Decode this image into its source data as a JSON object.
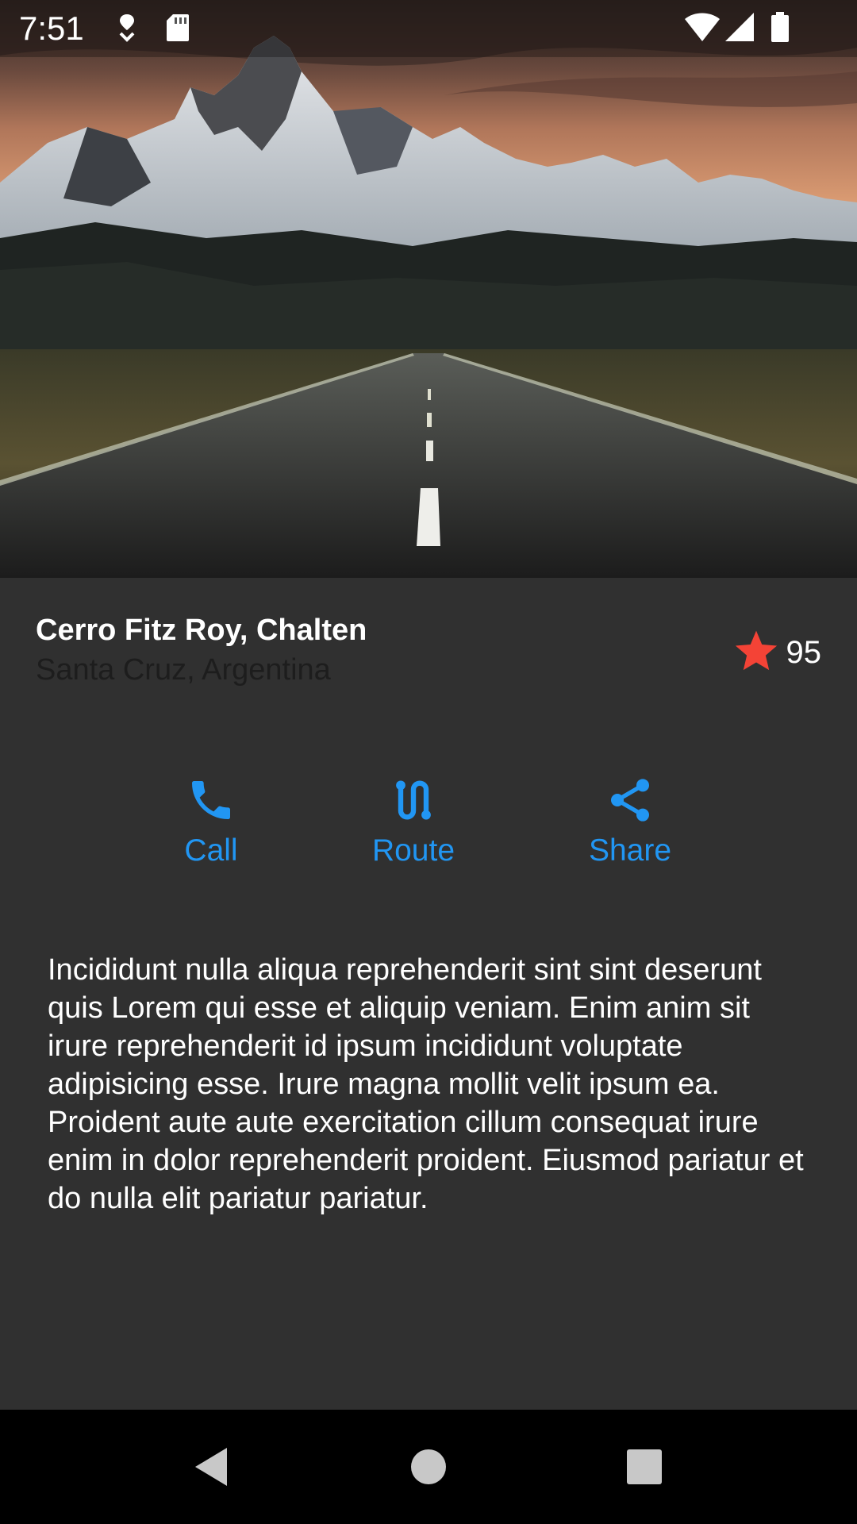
{
  "status_bar": {
    "time": "7:51"
  },
  "place": {
    "title": "Cerro Fitz Roy, Chalten",
    "subtitle": "Santa Cruz, Argentina",
    "rating_count": "95"
  },
  "actions": [
    {
      "label": "Call",
      "icon": "phone-icon"
    },
    {
      "label": "Route",
      "icon": "route-icon"
    },
    {
      "label": "Share",
      "icon": "share-icon"
    }
  ],
  "description": "Incididunt nulla aliqua reprehenderit sint sint deserunt quis Lorem qui esse et aliquip veniam. Enim anim sit irure reprehenderit id ipsum incididunt voluptate adipisicing esse. Irure magna mollit velit ipsum ea. Proident aute aute exercitation cillum consequat irure enim in dolor reprehenderit proident. Eiusmod pariatur et do nulla elit pariatur pariatur.",
  "colors": {
    "accent": "#2196f3",
    "star": "#f44336",
    "background": "#303030",
    "subtitle": "#1d1d1d"
  }
}
